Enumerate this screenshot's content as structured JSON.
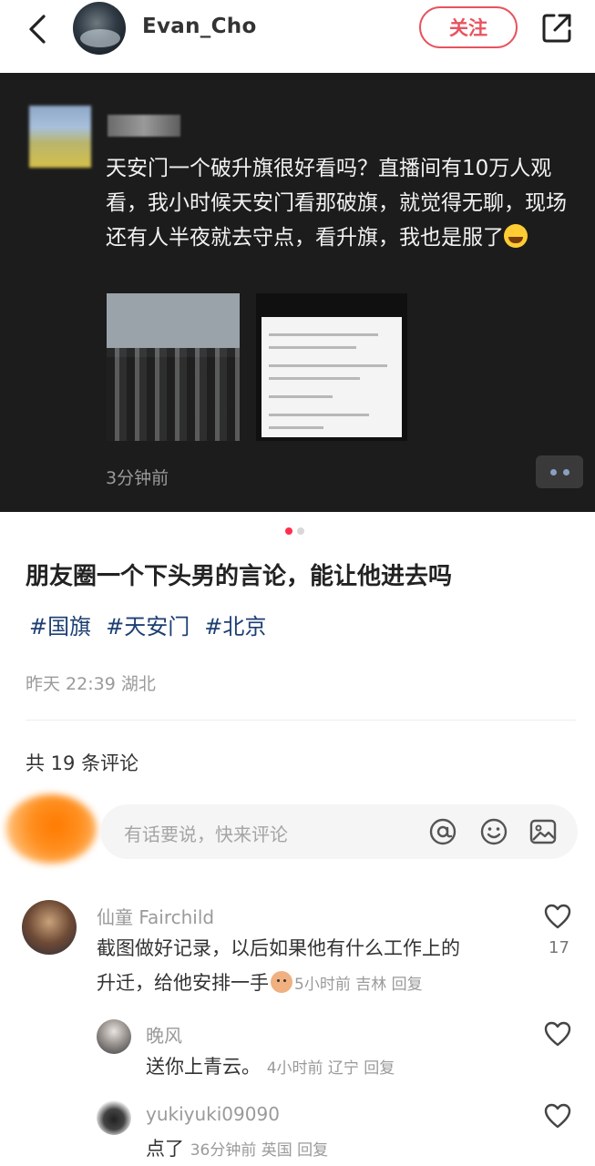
{
  "header": {
    "username": "Evan_Cho",
    "follow_label": "关注"
  },
  "moment": {
    "text_part": "天安门一个破升旗很好看吗？直播间有10万人观看，我小时候天安门看那破旗，就觉得无聊，现场还有人半夜就去守点，看升旗，我也是服了",
    "time_ago": "3分钟前"
  },
  "carousel": {
    "pages": 2,
    "current": 1
  },
  "post": {
    "title": "朋友圈一个下头男的言论，能让他进去吗",
    "tags": [
      "#国旗",
      "#天安门",
      "#北京"
    ],
    "meta": "昨天 22:39 湖北"
  },
  "comments_header": {
    "count_label": "共 19 条评论"
  },
  "comment_input": {
    "placeholder": "有话要说，快来评论"
  },
  "comments": [
    {
      "name": "仙童 Fairchild",
      "text_line1": "截图做好记录，以后如果他有什么工作上的",
      "text_line2": "升迁，给他安排一手",
      "meta": "5小时前 吉林 回复",
      "likes": "17"
    },
    {
      "name": "晚风",
      "text": "送你上青云。",
      "meta": "4小时前 辽宁 回复"
    },
    {
      "name": "yukiyuki09090",
      "text": "点了",
      "meta": "36分钟前 英国 回复"
    }
  ],
  "colors": {
    "accent": "#e8535f",
    "tag": "#1d3f73",
    "muted": "#9a9a9a",
    "dark_bg": "#1c1c1c"
  }
}
